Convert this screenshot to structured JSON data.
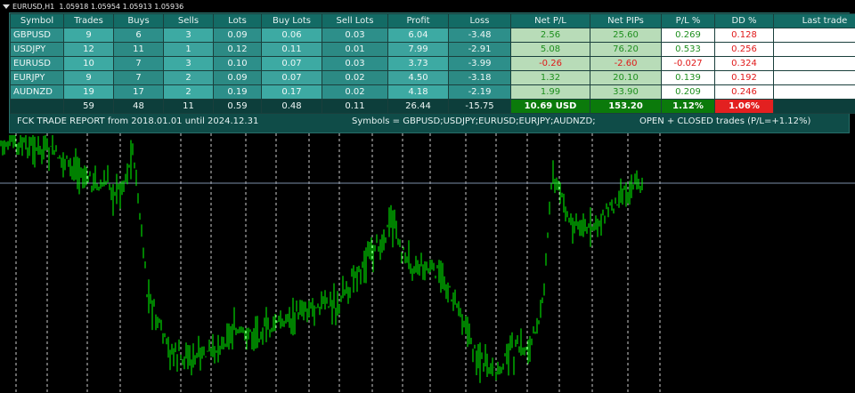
{
  "chart": {
    "symbol": "EURUSD,H1",
    "ohlc": "1.05918 1.05954 1.05913 1.05936",
    "candle_color": "#00ff00",
    "separator_color": "#ffffff",
    "price_line_color": "#7d8ea8"
  },
  "report": {
    "columns": [
      "Symbol",
      "Trades",
      "Buys",
      "Sells",
      "Lots",
      "Buy Lots",
      "Sell Lots",
      "Profit",
      "Loss",
      "Net P/L",
      "Net PIPs",
      "P/L %",
      "DD %",
      "Last trade"
    ],
    "rows": [
      {
        "symbol": "GBPUSD",
        "trades": "9",
        "buys": "6",
        "sells": "3",
        "lots": "0.09",
        "buy_lots": "0.06",
        "sell_lots": "0.03",
        "profit": "6.04",
        "loss": "-3.48",
        "net_pl": "2.56",
        "net_pips": "25.60",
        "pl_pct": "0.269",
        "dd_pct": "0.128",
        "last_trade": ""
      },
      {
        "symbol": "USDJPY",
        "trades": "12",
        "buys": "11",
        "sells": "1",
        "lots": "0.12",
        "buy_lots": "0.11",
        "sell_lots": "0.01",
        "profit": "7.99",
        "loss": "-2.91",
        "net_pl": "5.08",
        "net_pips": "76.20",
        "pl_pct": "0.533",
        "dd_pct": "0.256",
        "last_trade": ""
      },
      {
        "symbol": "EURUSD",
        "trades": "10",
        "buys": "7",
        "sells": "3",
        "lots": "0.10",
        "buy_lots": "0.07",
        "sell_lots": "0.03",
        "profit": "3.73",
        "loss": "-3.99",
        "net_pl": "-0.26",
        "net_pips": "-2.60",
        "pl_pct": "-0.027",
        "dd_pct": "0.324",
        "last_trade": ""
      },
      {
        "symbol": "EURJPY",
        "trades": "9",
        "buys": "7",
        "sells": "2",
        "lots": "0.09",
        "buy_lots": "0.07",
        "sell_lots": "0.02",
        "profit": "4.50",
        "loss": "-3.18",
        "net_pl": "1.32",
        "net_pips": "20.10",
        "pl_pct": "0.139",
        "dd_pct": "0.192",
        "last_trade": ""
      },
      {
        "symbol": "AUDNZD",
        "trades": "19",
        "buys": "17",
        "sells": "2",
        "lots": "0.19",
        "buy_lots": "0.17",
        "sell_lots": "0.02",
        "profit": "4.18",
        "loss": "-2.19",
        "net_pl": "1.99",
        "net_pips": "33.90",
        "pl_pct": "0.209",
        "dd_pct": "0.246",
        "last_trade": ""
      }
    ],
    "totals": {
      "symbol": "",
      "trades": "59",
      "buys": "48",
      "sells": "11",
      "lots": "0.59",
      "buy_lots": "0.48",
      "sell_lots": "0.11",
      "profit": "26.44",
      "loss": "-15.75",
      "net_pl": "10.69 USD",
      "net_pips": "153.20",
      "pl_pct": "1.12%",
      "dd_pct": "1.06%",
      "last_trade": ""
    },
    "footer": {
      "title": "FCK TRADE REPORT from 2018.01.01 until 2024.12.31",
      "symbols": "Symbols = GBPUSD;USDJPY;EURUSD;EURJPY;AUDNZD;",
      "mode": "OPEN + CLOSED trades (P/L=+1.12%)"
    },
    "colors": {
      "panel": "#0f4c48",
      "header": "#136b65",
      "positive": "#1e8f1e",
      "negative": "#e01818",
      "total_net_bg": "#0b7a0b",
      "total_dd_bg": "#e32020"
    }
  }
}
